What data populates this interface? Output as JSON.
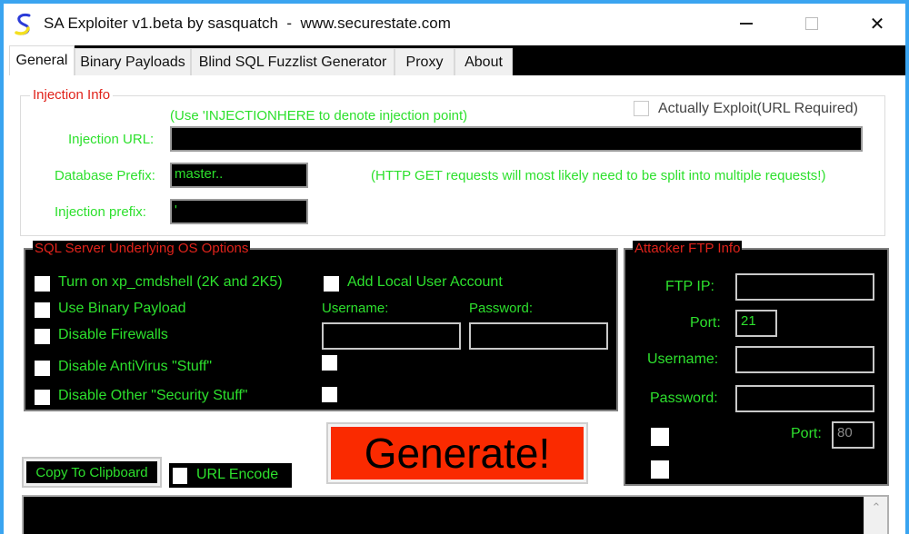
{
  "window": {
    "title": "SA Exploiter v1.beta by sasquatch  -  www.securestate.com",
    "controls": {
      "minimize": "minimize",
      "maximize": "maximize",
      "close": "✕"
    }
  },
  "tabs": [
    {
      "label": "General",
      "active": true
    },
    {
      "label": "Binary Payloads",
      "active": false
    },
    {
      "label": "Blind SQL Fuzzlist Generator",
      "active": false
    },
    {
      "label": "Proxy",
      "active": false
    },
    {
      "label": "About",
      "active": false
    }
  ],
  "injection_info": {
    "title": "Injection Info",
    "hint": "(Use 'INJECTIONHERE to denote injection point)",
    "actually_exploit_label": "Actually Exploit(URL Required)",
    "actually_exploit_checked": false,
    "url_label": "Injection URL:",
    "url_value": "",
    "db_prefix_label": "Database Prefix:",
    "db_prefix_value": "master..",
    "get_note": "(HTTP GET requests will most likely need to be split into multiple requests!)",
    "injection_prefix_label": "Injection prefix:",
    "injection_prefix_value": "'"
  },
  "os_options": {
    "title": "SQL Server Underlying OS Options",
    "checks": [
      {
        "label": "Turn on xp_cmdshell (2K and 2K5)",
        "checked": false
      },
      {
        "label": "Use Binary Payload",
        "checked": false
      },
      {
        "label": "Disable Firewalls",
        "checked": false
      },
      {
        "label": "Disable AntiVirus \"Stuff\"",
        "checked": false
      },
      {
        "label": "Disable Other \"Security Stuff\"",
        "checked": false
      }
    ],
    "add_user_label": "Add Local User Account",
    "add_user_checked": false,
    "username_label": "Username:",
    "username_value": "",
    "password_label": "Password:",
    "password_value": ""
  },
  "ftp_info": {
    "title": "Attacker FTP Info",
    "ip_label": "FTP IP:",
    "ip_value": "",
    "port_label": "Port:",
    "port_value": "21",
    "username_label": "Username:",
    "username_value": "",
    "password_label": "Password:",
    "password_value": "",
    "port2_label": "Port:",
    "port2_value": "80"
  },
  "bottom": {
    "copy_label": "Copy To Clipboard",
    "url_encode_label": "URL Encode",
    "url_encode_checked": false,
    "generate_label": "Generate!",
    "output_value": ""
  },
  "colors": {
    "accent_green": "#2de02d",
    "title_red": "#e0231b",
    "generate_red": "#fa2a00"
  }
}
